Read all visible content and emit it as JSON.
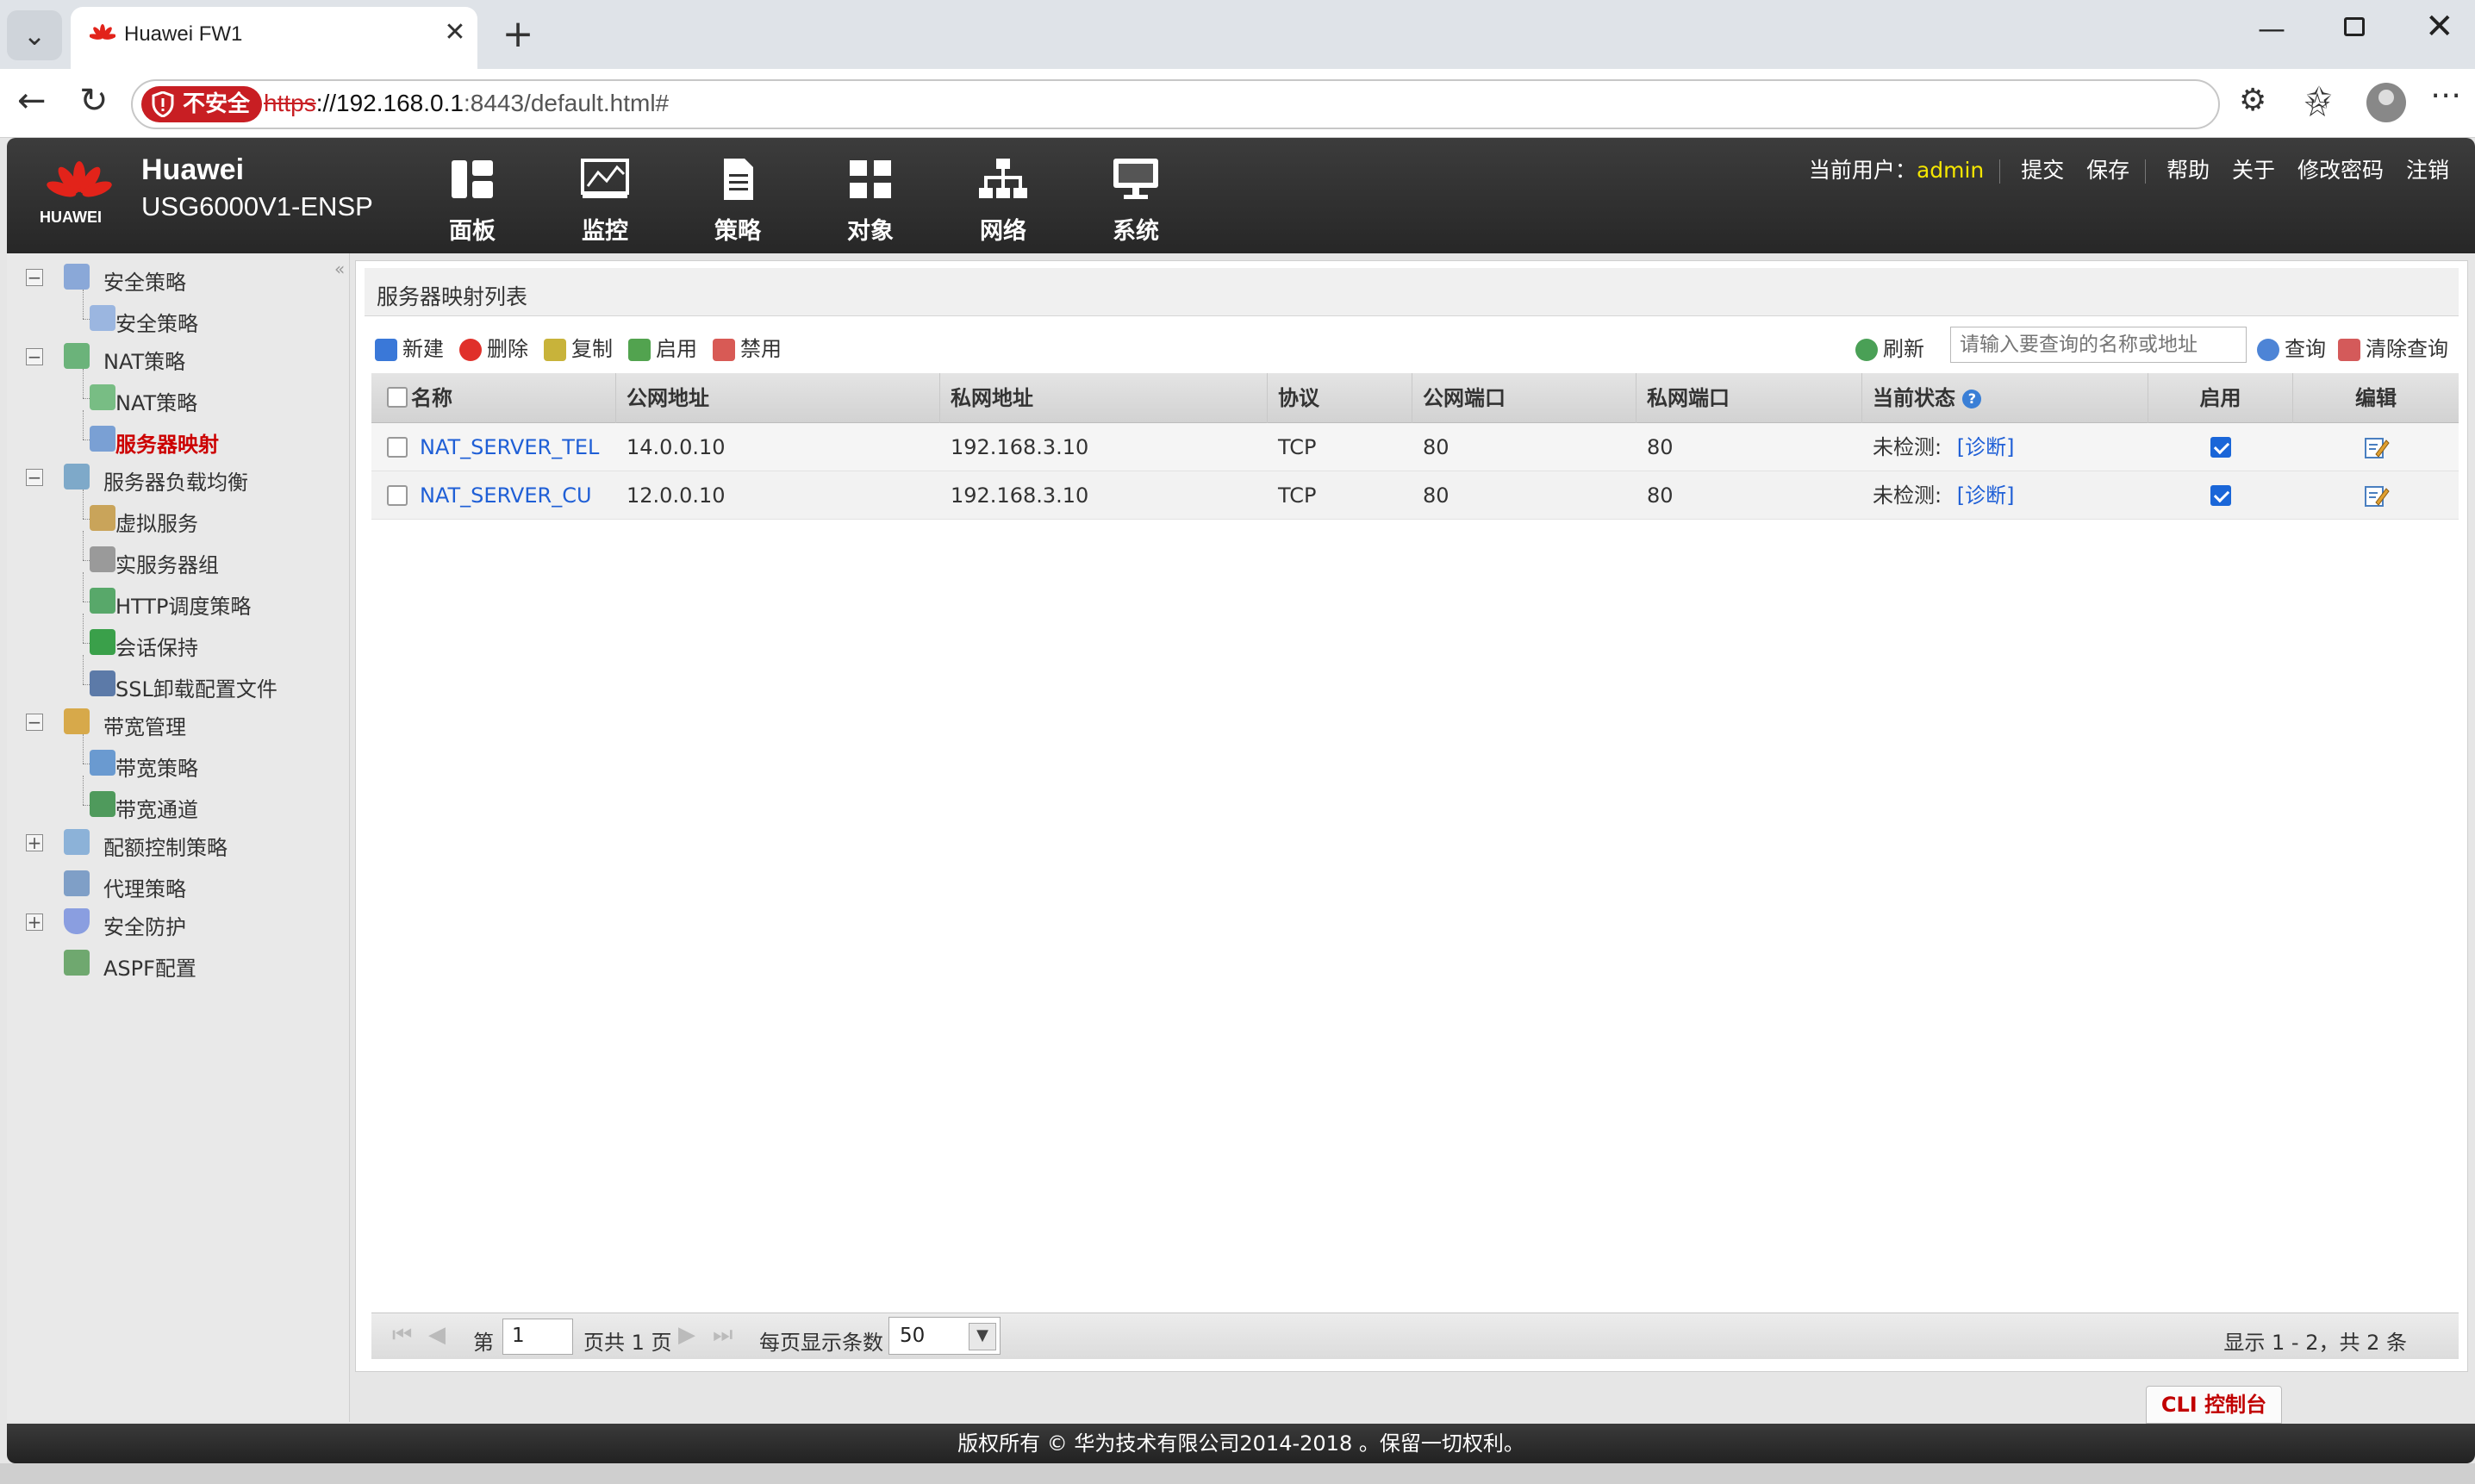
{
  "browser": {
    "tab_title": "Huawei FW1",
    "security_label": "不安全",
    "url_scheme": "https",
    "url_host": "://192.168.0.1",
    "url_rest": ":8443/default.html#"
  },
  "header": {
    "brand": "Huawei",
    "logo_text": "HUAWEI",
    "model": "USG6000V1-ENSP",
    "menu": [
      "面板",
      "监控",
      "策略",
      "对象",
      "网络",
      "系统"
    ],
    "current_user_label": "当前用户：",
    "current_user": "admin",
    "links": [
      "提交",
      "保存",
      "帮助",
      "关于",
      "修改密码",
      "注销"
    ]
  },
  "sidebar": {
    "items": [
      {
        "label": "安全策略",
        "level": 0,
        "expander": "−"
      },
      {
        "label": "安全策略",
        "level": 1
      },
      {
        "label": "NAT策略",
        "level": 0,
        "expander": "−"
      },
      {
        "label": "NAT策略",
        "level": 1
      },
      {
        "label": "服务器映射",
        "level": 1,
        "active": true
      },
      {
        "label": "服务器负载均衡",
        "level": 0,
        "expander": "−"
      },
      {
        "label": "虚拟服务",
        "level": 1
      },
      {
        "label": "实服务器组",
        "level": 1
      },
      {
        "label": "HTTP调度策略",
        "level": 1
      },
      {
        "label": "会话保持",
        "level": 1
      },
      {
        "label": "SSL卸载配置文件",
        "level": 1
      },
      {
        "label": "带宽管理",
        "level": 0,
        "expander": "−"
      },
      {
        "label": "带宽策略",
        "level": 1
      },
      {
        "label": "带宽通道",
        "level": 1
      },
      {
        "label": "配额控制策略",
        "level": 0,
        "expander": "+"
      },
      {
        "label": "代理策略",
        "level": 0
      },
      {
        "label": "安全防护",
        "level": 0,
        "expander": "+"
      },
      {
        "label": "ASPF配置",
        "level": 0
      }
    ]
  },
  "panel": {
    "title": "服务器映射列表",
    "toolbar": {
      "new": "新建",
      "delete": "删除",
      "copy": "复制",
      "enable": "启用",
      "disable": "禁用",
      "refresh": "刷新",
      "search_placeholder": "请输入要查询的名称或地址",
      "search": "查询",
      "clear_search": "清除查询"
    },
    "columns": [
      "名称",
      "公网地址",
      "私网地址",
      "协议",
      "公网端口",
      "私网端口",
      "当前状态",
      "启用",
      "编辑"
    ],
    "rows": [
      {
        "name": "NAT_SERVER_TEL",
        "public_ip": "14.0.0.10",
        "private_ip": "192.168.3.10",
        "protocol": "TCP",
        "public_port": "80",
        "private_port": "80",
        "status": "未检测:",
        "diagnose": "[诊断]",
        "enabled": true
      },
      {
        "name": "NAT_SERVER_CU",
        "public_ip": "12.0.0.10",
        "private_ip": "192.168.3.10",
        "protocol": "TCP",
        "public_port": "80",
        "private_port": "80",
        "status": "未检测:",
        "diagnose": "[诊断]",
        "enabled": true
      }
    ],
    "pager": {
      "page_prefix": "第",
      "page_value": "1",
      "page_suffix": "页共 1 页",
      "per_page_label": "每页显示条数",
      "per_page_value": "50",
      "summary": "显示 1 - 2，共 2 条"
    }
  },
  "cli_button": "CLI 控制台",
  "footer": "版权所有 © 华为技术有限公司2014-2018 。保留一切权利。",
  "colors": {
    "accent_red": "#c81e23",
    "link_blue": "#1f5fd6",
    "user_yellow": "#f5e600",
    "header_bg": "#2f2f2f"
  }
}
